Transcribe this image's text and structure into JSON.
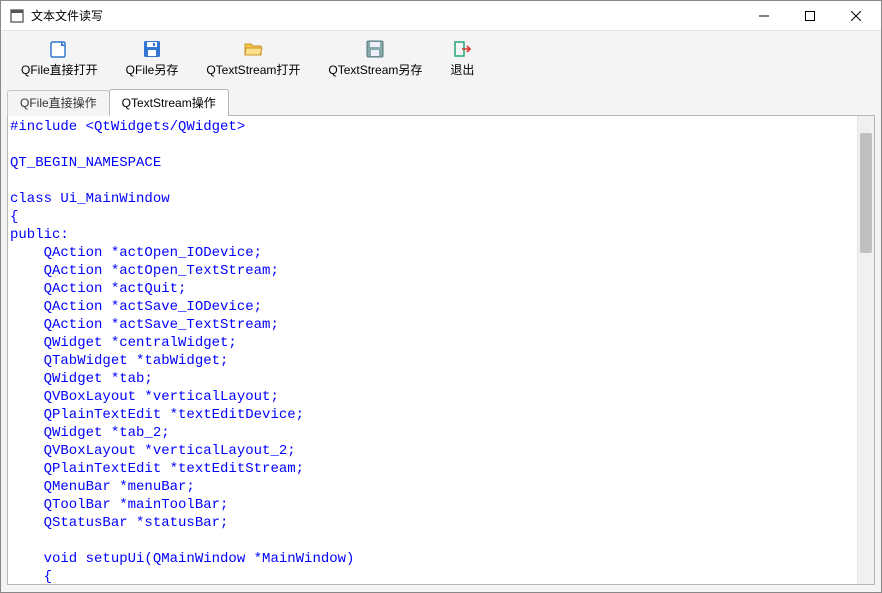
{
  "window": {
    "title": "文本文件读写"
  },
  "toolbar": {
    "items": [
      {
        "label": "QFile直接打开"
      },
      {
        "label": "QFile另存"
      },
      {
        "label": "QTextStream打开"
      },
      {
        "label": "QTextStream另存"
      },
      {
        "label": "退出"
      }
    ]
  },
  "tabs": {
    "items": [
      {
        "label": "QFile直接操作",
        "active": false
      },
      {
        "label": "QTextStream操作",
        "active": true
      }
    ]
  },
  "editor": {
    "content": "#include <QtWidgets/QWidget>\n\nQT_BEGIN_NAMESPACE\n\nclass Ui_MainWindow\n{\npublic:\n    QAction *actOpen_IODevice;\n    QAction *actOpen_TextStream;\n    QAction *actQuit;\n    QAction *actSave_IODevice;\n    QAction *actSave_TextStream;\n    QWidget *centralWidget;\n    QTabWidget *tabWidget;\n    QWidget *tab;\n    QVBoxLayout *verticalLayout;\n    QPlainTextEdit *textEditDevice;\n    QWidget *tab_2;\n    QVBoxLayout *verticalLayout_2;\n    QPlainTextEdit *textEditStream;\n    QMenuBar *menuBar;\n    QToolBar *mainToolBar;\n    QStatusBar *statusBar;\n\n    void setupUi(QMainWindow *MainWindow)\n    {"
  }
}
